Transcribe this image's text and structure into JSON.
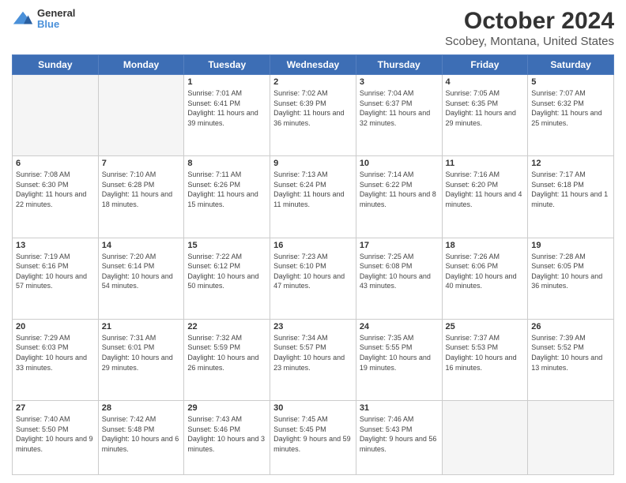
{
  "header": {
    "logo": {
      "line1": "General",
      "line2": "Blue"
    },
    "title": "October 2024",
    "subtitle": "Scobey, Montana, United States"
  },
  "days_of_week": [
    "Sunday",
    "Monday",
    "Tuesday",
    "Wednesday",
    "Thursday",
    "Friday",
    "Saturday"
  ],
  "weeks": [
    [
      {
        "day": "",
        "info": ""
      },
      {
        "day": "",
        "info": ""
      },
      {
        "day": "1",
        "info": "Sunrise: 7:01 AM\nSunset: 6:41 PM\nDaylight: 11 hours and 39 minutes."
      },
      {
        "day": "2",
        "info": "Sunrise: 7:02 AM\nSunset: 6:39 PM\nDaylight: 11 hours and 36 minutes."
      },
      {
        "day": "3",
        "info": "Sunrise: 7:04 AM\nSunset: 6:37 PM\nDaylight: 11 hours and 32 minutes."
      },
      {
        "day": "4",
        "info": "Sunrise: 7:05 AM\nSunset: 6:35 PM\nDaylight: 11 hours and 29 minutes."
      },
      {
        "day": "5",
        "info": "Sunrise: 7:07 AM\nSunset: 6:32 PM\nDaylight: 11 hours and 25 minutes."
      }
    ],
    [
      {
        "day": "6",
        "info": "Sunrise: 7:08 AM\nSunset: 6:30 PM\nDaylight: 11 hours and 22 minutes."
      },
      {
        "day": "7",
        "info": "Sunrise: 7:10 AM\nSunset: 6:28 PM\nDaylight: 11 hours and 18 minutes."
      },
      {
        "day": "8",
        "info": "Sunrise: 7:11 AM\nSunset: 6:26 PM\nDaylight: 11 hours and 15 minutes."
      },
      {
        "day": "9",
        "info": "Sunrise: 7:13 AM\nSunset: 6:24 PM\nDaylight: 11 hours and 11 minutes."
      },
      {
        "day": "10",
        "info": "Sunrise: 7:14 AM\nSunset: 6:22 PM\nDaylight: 11 hours and 8 minutes."
      },
      {
        "day": "11",
        "info": "Sunrise: 7:16 AM\nSunset: 6:20 PM\nDaylight: 11 hours and 4 minutes."
      },
      {
        "day": "12",
        "info": "Sunrise: 7:17 AM\nSunset: 6:18 PM\nDaylight: 11 hours and 1 minute."
      }
    ],
    [
      {
        "day": "13",
        "info": "Sunrise: 7:19 AM\nSunset: 6:16 PM\nDaylight: 10 hours and 57 minutes."
      },
      {
        "day": "14",
        "info": "Sunrise: 7:20 AM\nSunset: 6:14 PM\nDaylight: 10 hours and 54 minutes."
      },
      {
        "day": "15",
        "info": "Sunrise: 7:22 AM\nSunset: 6:12 PM\nDaylight: 10 hours and 50 minutes."
      },
      {
        "day": "16",
        "info": "Sunrise: 7:23 AM\nSunset: 6:10 PM\nDaylight: 10 hours and 47 minutes."
      },
      {
        "day": "17",
        "info": "Sunrise: 7:25 AM\nSunset: 6:08 PM\nDaylight: 10 hours and 43 minutes."
      },
      {
        "day": "18",
        "info": "Sunrise: 7:26 AM\nSunset: 6:06 PM\nDaylight: 10 hours and 40 minutes."
      },
      {
        "day": "19",
        "info": "Sunrise: 7:28 AM\nSunset: 6:05 PM\nDaylight: 10 hours and 36 minutes."
      }
    ],
    [
      {
        "day": "20",
        "info": "Sunrise: 7:29 AM\nSunset: 6:03 PM\nDaylight: 10 hours and 33 minutes."
      },
      {
        "day": "21",
        "info": "Sunrise: 7:31 AM\nSunset: 6:01 PM\nDaylight: 10 hours and 29 minutes."
      },
      {
        "day": "22",
        "info": "Sunrise: 7:32 AM\nSunset: 5:59 PM\nDaylight: 10 hours and 26 minutes."
      },
      {
        "day": "23",
        "info": "Sunrise: 7:34 AM\nSunset: 5:57 PM\nDaylight: 10 hours and 23 minutes."
      },
      {
        "day": "24",
        "info": "Sunrise: 7:35 AM\nSunset: 5:55 PM\nDaylight: 10 hours and 19 minutes."
      },
      {
        "day": "25",
        "info": "Sunrise: 7:37 AM\nSunset: 5:53 PM\nDaylight: 10 hours and 16 minutes."
      },
      {
        "day": "26",
        "info": "Sunrise: 7:39 AM\nSunset: 5:52 PM\nDaylight: 10 hours and 13 minutes."
      }
    ],
    [
      {
        "day": "27",
        "info": "Sunrise: 7:40 AM\nSunset: 5:50 PM\nDaylight: 10 hours and 9 minutes."
      },
      {
        "day": "28",
        "info": "Sunrise: 7:42 AM\nSunset: 5:48 PM\nDaylight: 10 hours and 6 minutes."
      },
      {
        "day": "29",
        "info": "Sunrise: 7:43 AM\nSunset: 5:46 PM\nDaylight: 10 hours and 3 minutes."
      },
      {
        "day": "30",
        "info": "Sunrise: 7:45 AM\nSunset: 5:45 PM\nDaylight: 9 hours and 59 minutes."
      },
      {
        "day": "31",
        "info": "Sunrise: 7:46 AM\nSunset: 5:43 PM\nDaylight: 9 hours and 56 minutes."
      },
      {
        "day": "",
        "info": ""
      },
      {
        "day": "",
        "info": ""
      }
    ]
  ]
}
